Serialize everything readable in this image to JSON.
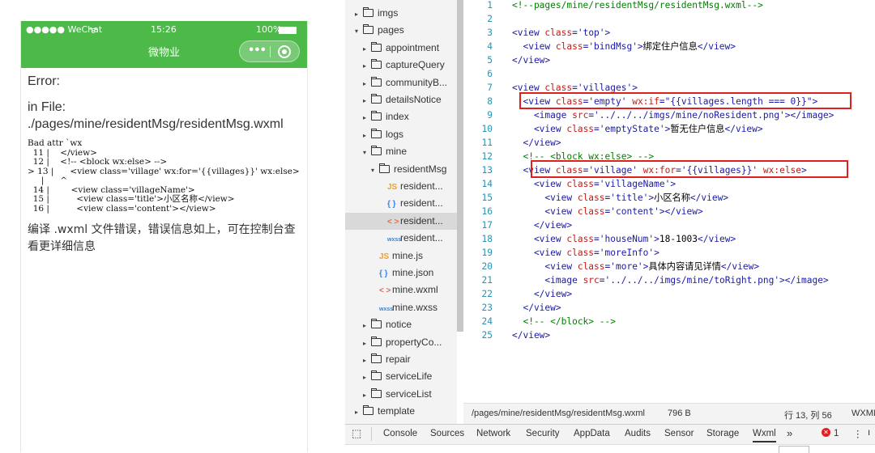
{
  "simulator": {
    "status": {
      "signal": "●●●●● WeChat",
      "wifi": "ᯤ",
      "time": "15:26",
      "battery": "100%"
    },
    "nav_title": "微物业",
    "error_title": "Error:",
    "error_file": "in File: ./pages/mine/residentMsg/residentMsg.wxml",
    "error_code": "Bad attr `wx\n  11 |    </view>\n  12 |    <!-- <block wx:else> -->\n> 13 |      <view class='village' wx:for='{{villages}}' wx:else>\n     |      ^\n  14 |        <view class='villageName'>\n  15 |          <view class='title'>小区名称</view>\n  16 |          <view class='content'></view>",
    "error_message": "编译 .wxml 文件错误，错误信息如上，可在控制台查看更详细信息"
  },
  "tree": {
    "items": [
      {
        "arrow": "▸",
        "label": "imgs",
        "indent": 0,
        "kind": "folder"
      },
      {
        "arrow": "▾",
        "label": "pages",
        "indent": 0,
        "kind": "folder-open"
      },
      {
        "arrow": "▸",
        "label": "appointment",
        "indent": 1,
        "kind": "folder"
      },
      {
        "arrow": "▸",
        "label": "captureQuery",
        "indent": 1,
        "kind": "folder"
      },
      {
        "arrow": "▸",
        "label": "communityB...",
        "indent": 1,
        "kind": "folder"
      },
      {
        "arrow": "▸",
        "label": "detailsNotice",
        "indent": 1,
        "kind": "folder"
      },
      {
        "arrow": "▸",
        "label": "index",
        "indent": 1,
        "kind": "folder"
      },
      {
        "arrow": "▸",
        "label": "logs",
        "indent": 1,
        "kind": "folder"
      },
      {
        "arrow": "▾",
        "label": "mine",
        "indent": 1,
        "kind": "folder-open"
      },
      {
        "arrow": "▾",
        "label": "residentMsg",
        "indent": 2,
        "kind": "folder-open"
      },
      {
        "arrow": "",
        "label": "resident...",
        "indent": 3,
        "kind": "js"
      },
      {
        "arrow": "",
        "label": "resident...",
        "indent": 3,
        "kind": "json"
      },
      {
        "arrow": "",
        "label": "resident...",
        "indent": 3,
        "kind": "wxml",
        "selected": true
      },
      {
        "arrow": "",
        "label": "resident...",
        "indent": 3,
        "kind": "wxss"
      },
      {
        "arrow": "",
        "label": "mine.js",
        "indent": 2,
        "kind": "js"
      },
      {
        "arrow": "",
        "label": "mine.json",
        "indent": 2,
        "kind": "json"
      },
      {
        "arrow": "",
        "label": "mine.wxml",
        "indent": 2,
        "kind": "wxml"
      },
      {
        "arrow": "",
        "label": "mine.wxss",
        "indent": 2,
        "kind": "wxss"
      },
      {
        "arrow": "▸",
        "label": "notice",
        "indent": 1,
        "kind": "folder"
      },
      {
        "arrow": "▸",
        "label": "propertyCo...",
        "indent": 1,
        "kind": "folder"
      },
      {
        "arrow": "▸",
        "label": "repair",
        "indent": 1,
        "kind": "folder"
      },
      {
        "arrow": "▸",
        "label": "serviceLife",
        "indent": 1,
        "kind": "folder"
      },
      {
        "arrow": "▸",
        "label": "serviceList",
        "indent": 1,
        "kind": "folder"
      },
      {
        "arrow": "▸",
        "label": "template",
        "indent": 0,
        "kind": "folder"
      }
    ],
    "icons": {
      "js": "JS",
      "json": "{ }",
      "wxml": "< >",
      "wxss": "wxss"
    }
  },
  "editor": {
    "lines": [
      {
        "n": "1",
        "segs": [
          [
            "cmt",
            "<!--pages/mine/residentMsg/residentMsg.wxml-->"
          ]
        ]
      },
      {
        "n": "2",
        "segs": []
      },
      {
        "n": "3",
        "segs": [
          [
            "tag",
            "<view "
          ],
          [
            "attr",
            "class"
          ],
          [
            "tag",
            "='top'>"
          ]
        ]
      },
      {
        "n": "4",
        "segs": [
          [
            "tag",
            "  <view "
          ],
          [
            "attr",
            "class"
          ],
          [
            "tag",
            "='bindMsg'>"
          ],
          [
            "txt",
            "绑定住户信息"
          ],
          [
            "tag",
            "</view>"
          ]
        ]
      },
      {
        "n": "5",
        "segs": [
          [
            "tag",
            "</view>"
          ]
        ]
      },
      {
        "n": "6",
        "segs": []
      },
      {
        "n": "7",
        "segs": [
          [
            "tag",
            "<view "
          ],
          [
            "attr",
            "class"
          ],
          [
            "tag",
            "='villages'>"
          ]
        ]
      },
      {
        "n": "8",
        "segs": [
          [
            "tag",
            "  <view "
          ],
          [
            "attr",
            "class"
          ],
          [
            "tag",
            "='empty' "
          ],
          [
            "attr",
            "wx:if"
          ],
          [
            "tag",
            "=\"{{villages.length === 0}}\">"
          ]
        ]
      },
      {
        "n": "9",
        "segs": [
          [
            "tag",
            "    <image "
          ],
          [
            "attr",
            "src"
          ],
          [
            "tag",
            "='../../../imgs/mine/noResident.png'></image>"
          ]
        ]
      },
      {
        "n": "10",
        "segs": [
          [
            "tag",
            "    <view "
          ],
          [
            "attr",
            "class"
          ],
          [
            "tag",
            "='emptyState'>"
          ],
          [
            "txt",
            "暂无住户信息"
          ],
          [
            "tag",
            "</view>"
          ]
        ]
      },
      {
        "n": "11",
        "segs": [
          [
            "tag",
            "  </view>"
          ]
        ]
      },
      {
        "n": "12",
        "segs": [
          [
            "cmt",
            "  <!-- <block wx:else> -->"
          ]
        ]
      },
      {
        "n": "13",
        "segs": [
          [
            "tag",
            "  <view "
          ],
          [
            "attr",
            "class"
          ],
          [
            "tag",
            "='village' "
          ],
          [
            "attr",
            "wx:for"
          ],
          [
            "tag",
            "='{{villages}}' "
          ],
          [
            "attr",
            "wx:else"
          ],
          [
            "tag",
            ">"
          ]
        ]
      },
      {
        "n": "14",
        "segs": [
          [
            "tag",
            "    <view "
          ],
          [
            "attr",
            "class"
          ],
          [
            "tag",
            "='villageName'>"
          ]
        ]
      },
      {
        "n": "15",
        "segs": [
          [
            "tag",
            "      <view "
          ],
          [
            "attr",
            "class"
          ],
          [
            "tag",
            "='title'>"
          ],
          [
            "txt",
            "小区名称"
          ],
          [
            "tag",
            "</view>"
          ]
        ]
      },
      {
        "n": "16",
        "segs": [
          [
            "tag",
            "      <view "
          ],
          [
            "attr",
            "class"
          ],
          [
            "tag",
            "='content'></view>"
          ]
        ]
      },
      {
        "n": "17",
        "segs": [
          [
            "tag",
            "    </view>"
          ]
        ]
      },
      {
        "n": "18",
        "segs": [
          [
            "tag",
            "    <view "
          ],
          [
            "attr",
            "class"
          ],
          [
            "tag",
            "='houseNum'>"
          ],
          [
            "txt",
            "18-1003"
          ],
          [
            "tag",
            "</view>"
          ]
        ]
      },
      {
        "n": "19",
        "segs": [
          [
            "tag",
            "    <view "
          ],
          [
            "attr",
            "class"
          ],
          [
            "tag",
            "='moreInfo'>"
          ]
        ]
      },
      {
        "n": "20",
        "segs": [
          [
            "tag",
            "      <view "
          ],
          [
            "attr",
            "class"
          ],
          [
            "tag",
            "='more'>"
          ],
          [
            "txt",
            "具体内容请见详情"
          ],
          [
            "tag",
            "</view>"
          ]
        ]
      },
      {
        "n": "21",
        "segs": [
          [
            "tag",
            "      <image "
          ],
          [
            "attr",
            "src"
          ],
          [
            "tag",
            "='../../../imgs/mine/toRight.png'></image>"
          ]
        ]
      },
      {
        "n": "22",
        "segs": [
          [
            "tag",
            "    </view>"
          ]
        ]
      },
      {
        "n": "23",
        "segs": [
          [
            "tag",
            "  </view>"
          ]
        ]
      },
      {
        "n": "24",
        "segs": [
          [
            "cmt",
            "  <!-- </block> -->"
          ]
        ]
      },
      {
        "n": "25",
        "segs": [
          [
            "tag",
            "</view>"
          ]
        ]
      }
    ]
  },
  "statusline": {
    "path": "/pages/mine/residentMsg/residentMsg.wxml",
    "size": "796 B",
    "position": "行 13, 列 56",
    "lang": "WXML"
  },
  "devtools": {
    "tabs": [
      "Console",
      "Sources",
      "Network",
      "Security",
      "AppData",
      "Audits",
      "Sensor",
      "Storage",
      "Wxml"
    ],
    "more": "»",
    "error_count": "1",
    "menu": "⋮",
    "inspect_icon": "inspect-icon"
  },
  "colors": {
    "wechat_green": "#4cb948",
    "highlight_red": "#e02020"
  }
}
